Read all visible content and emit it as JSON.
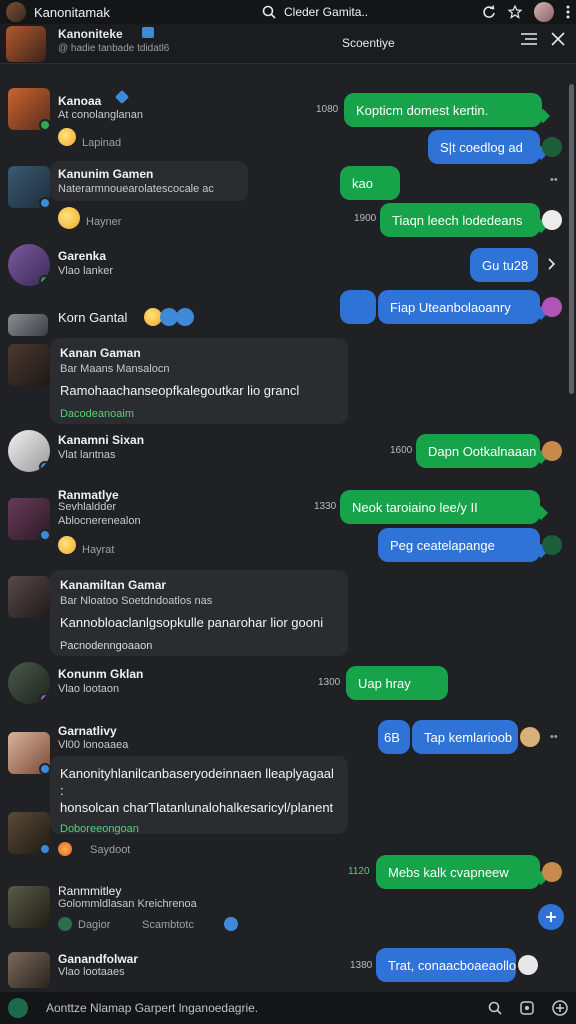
{
  "topbar": {
    "title": "Kanonitamak",
    "search_text": "Cleder Gamita.."
  },
  "channel": {
    "name": "Kanoniteke",
    "subtitle": "@ hadie tanbade tdidatl6",
    "center_label": "Scoentiye"
  },
  "feed": [
    {
      "name": "Kanoaa",
      "sub": "At conolanglanan",
      "meta": "Lapinad",
      "ts": "1080",
      "bubble": "Kopticm domest kertin.",
      "bubble2": "S|t   coedlog ad"
    },
    {
      "name": "Kanunim Gamen",
      "sub": "Naterarmnouearolatescocale ac",
      "meta": "Hayner",
      "ts": "1900",
      "bubble": "kao",
      "bubble2": "Tiaqn leech lodedeans"
    },
    {
      "name": "Garenka",
      "sub": "Vlao lanker",
      "bubble": "Gu    tu28"
    },
    {
      "name": "Korn Gantal",
      "bubble": "Fiap  Uteanbolaoanry"
    },
    {
      "name": "Kanan Gaman",
      "sub": "Bar Maans Mansalocn",
      "body": "Ramohaachanseopfkalegoutkar lio grancl",
      "foot": "Dacodeanoaim"
    },
    {
      "name": "Kanamni Sixan",
      "sub": "Vlat lantnas",
      "ts": "1600",
      "bubble": "Dapn Ootkalnaaan"
    },
    {
      "name": "Ranmatlye",
      "sub": "Sevhlaldder",
      "sub2": "Ablocnerenealon",
      "meta": "Hayrat",
      "ts": "1330",
      "bubble": "Neok taroiaino lee/y II",
      "bubble2": "Peg    ceatelapange"
    },
    {
      "name": "Kanamiltan Gamar",
      "sub": "Bar Nloatoo Soetdndoatlos nas",
      "body": "Kannobloaclanlgsopkulle panarohar lior gooni",
      "foot": "Pacnodenngoaaon"
    },
    {
      "name": "Konunm Gklan",
      "sub": "Vlao lootaon",
      "ts": "1300",
      "bubble": "Uap hray"
    },
    {
      "name": "Garnatlivy",
      "sub": "Vl00 lonoaaea",
      "bubble": "Tap  kemlarioob",
      "bubble_prefix": "6B"
    },
    {
      "body": "Kanonityhlanilcanbaseryodeinnaen lleaplyagaal :\nhonsolcan charTlatanlunalohalkesaricyl/planent",
      "foot": "Doboreeongoan"
    },
    {
      "meta": "Saydoot",
      "ts": "1120",
      "bubble": "Mebs kalk      cvapneew"
    },
    {
      "name": "Ranmmitley",
      "sub": "Golommldlasan Kreichrenoa",
      "meta": "Dagior",
      "meta2": "Scambtotc"
    },
    {
      "name": "Ganandfolwar",
      "sub": "Vlao lootaaes",
      "ts": "1380",
      "bubble": "Trat,  conaacboaeaollo"
    }
  ],
  "composer": {
    "placeholder": "Aonttze Nlamap Garpert lnganoedagrie."
  },
  "colors": {
    "green_bubble": "#17a34a",
    "blue_bubble": "#2f73d6",
    "background": "#202124"
  }
}
